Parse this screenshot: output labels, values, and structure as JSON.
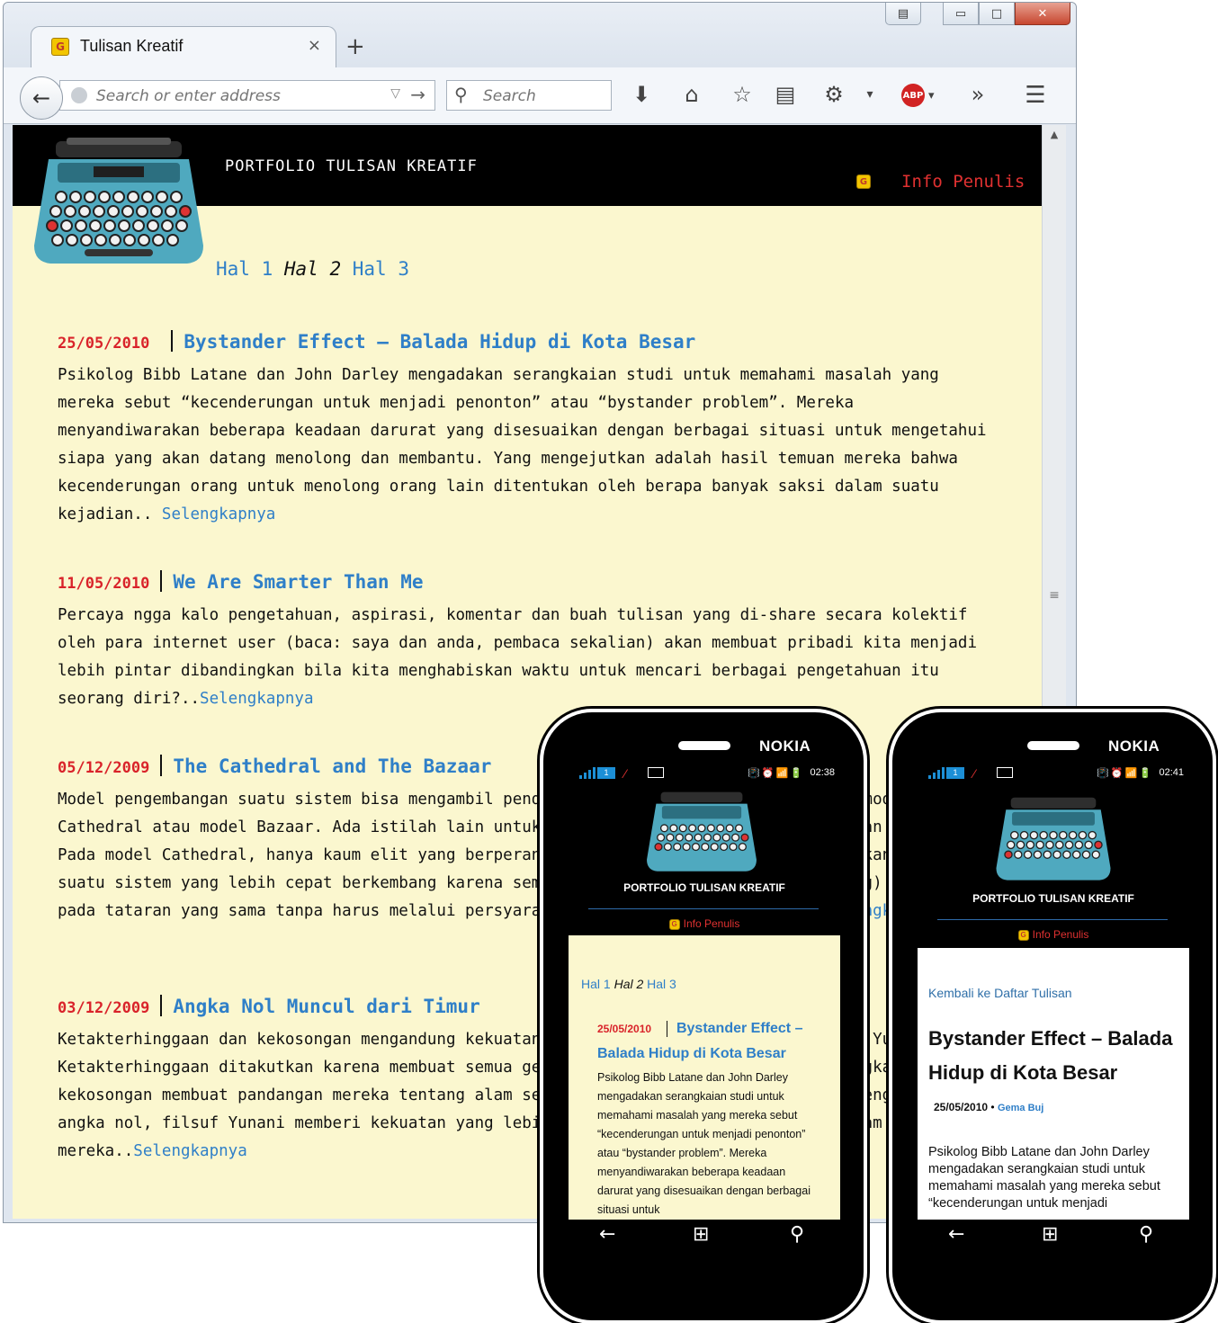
{
  "browser": {
    "tab_title": "Tulisan Kreatif",
    "tab_close": "×",
    "new_tab": "+",
    "window_controls": {
      "minimize": "▭",
      "maximize": "□",
      "close": "✕"
    },
    "url_placeholder": "Search or enter address",
    "search_placeholder": "Search",
    "icons": [
      "back-icon",
      "download-icon",
      "home-icon",
      "star-icon",
      "reading-list-icon",
      "settings-icon",
      "adblock-plus-icon",
      "overflow-icon",
      "menu-icon"
    ],
    "abp_label": "ABP"
  },
  "site": {
    "title": "PORTFOLIO TULISAN KREATIF",
    "info_link": "Info Penulis",
    "favicon_letter": "G",
    "pager": [
      {
        "label": "Hal 1",
        "current": false
      },
      {
        "label": "Hal 2",
        "current": true
      },
      {
        "label": "Hal 3",
        "current": false
      }
    ],
    "read_more": "Selengkapnya",
    "posts": [
      {
        "date": "25/05/2010",
        "title": "Bystander Effect – Balada Hidup di Kota Besar",
        "excerpt": "Psikolog Bibb Latane dan John Darley mengadakan serangkaian studi untuk memahami masalah yang mereka sebut “kecenderungan untuk menjadi penonton” atau “bystander problem”. Mereka menyandiwarakan beberapa keadaan darurat yang disesuaikan dengan berbagai situasi untuk mengetahui siapa yang akan datang menolong dan membantu. Yang mengejutkan adalah hasil temuan mereka bahwa kecenderungan orang untuk menolong orang lain ditentukan oleh berapa banyak saksi dalam suatu kejadian.. "
      },
      {
        "date": "11/05/2010",
        "title": "We Are Smarter Than Me",
        "excerpt": "Percaya ngga kalo pengetahuan, aspirasi, komentar dan buah tulisan yang di-share secara kolektif oleh para internet user (baca: saya dan anda, pembaca sekalian) akan membuat pribadi kita menjadi lebih pintar dibandingkan bila kita menghabiskan waktu untuk mencari berbagai pengetahuan itu seorang diri?.."
      },
      {
        "date": "05/12/2009",
        "title": "The Cathedral and The Bazaar",
        "excerpt": "Model pengembangan suatu sistem bisa mengambil pendekatan satu dari dua model, yaitu model Cathedral atau model Bazaar. Ada istilah lain untuk kedua model ini, yaitu Top Down dan Bottom Up. Pada model Cathedral, hanya kaum elit yang berperan, sedangkan model Bazaar memungkinkan menjadikan suatu sistem yang lebih cepat berkembang karena semua pihak (pengguna maupun perancang) diletakkan pada tataran yang sama tanpa harus melalui persyaratan penerimaan dari tim elit.."
      },
      {
        "date": "03/12/2009",
        "title": "Angka Nol Muncul dari Timur",
        "excerpt": "Ketakterhinggaan dan kekosongan mengandung kekuatan yang sangat menakutkan bagi orang Yunani. Ketakterhinggaan ditakutkan karena membuat semua gerakan menjadi tidak mungkin, sedangkan kekosongan membuat pandangan mereka tentang alam semesta menjadi hancur berantakan. Dengan menolak angka nol, filsuf Yunani memberi kekuatan yang lebih besar pada pandangan filsafat alam semesta mereka.."
      }
    ]
  },
  "phones": {
    "brand": "NOKIA",
    "phone1": {
      "time": "02:38",
      "sim": "1",
      "title": "PORTFOLIO TULISAN KREATIF",
      "info": "Info Penulis",
      "pager": [
        "Hal 1",
        "Hal 2",
        "Hal 3"
      ],
      "post_date": "25/05/2010",
      "post_title": "Bystander Effect – Balada Hidup di Kota Besar",
      "excerpt": "Psikolog Bibb Latane dan John Darley mengadakan serangkaian studi untuk memahami masalah yang mereka sebut “kecenderungan untuk menjadi penonton” atau “bystander problem”. Mereka menyandiwarakan beberapa keadaan darurat yang disesuaikan dengan berbagai situasi untuk"
    },
    "phone2": {
      "time": "02:41",
      "sim": "1",
      "title": "PORTFOLIO TULISAN KREATIF",
      "info": "Info Penulis",
      "back_link": "Kembali ke Daftar Tulisan",
      "article_title": "Bystander Effect – Balada Hidup di Kota Besar",
      "meta_date": "25/05/2010",
      "meta_sep": "•",
      "meta_author": "Gema Buj",
      "body": "Psikolog Bibb Latane dan John Darley mengadakan serangkaian studi untuk memahami masalah yang mereka sebut “kecenderungan untuk menjadi"
    },
    "nav_icons": [
      "back-arrow-icon",
      "windows-start-icon",
      "search-icon"
    ]
  }
}
